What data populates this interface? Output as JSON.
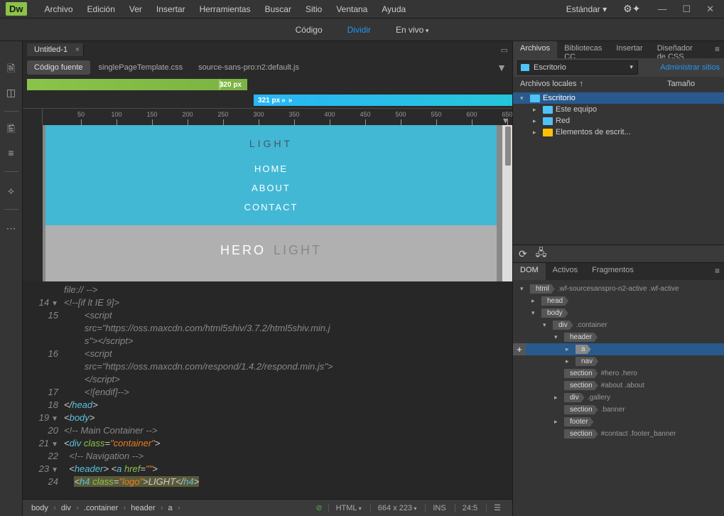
{
  "app": {
    "logo": "Dw"
  },
  "menu": [
    "Archivo",
    "Edición",
    "Ver",
    "Insertar",
    "Herramientas",
    "Buscar",
    "Sitio",
    "Ventana",
    "Ayuda"
  ],
  "workspace": "Estándar",
  "viewModes": {
    "code": "Código",
    "split": "Dividir",
    "live": "En vivo",
    "active": "split"
  },
  "document": {
    "tab": "Untitled-1",
    "sourceBtn": "Código fuente",
    "relatedFiles": [
      "singlePageTemplate.css",
      "source-sans-pro:n2:default.js"
    ]
  },
  "mediaQueries": {
    "bp1": "320  px",
    "bp2": "321  px"
  },
  "ruler": {
    "ticks": [
      50,
      100,
      150,
      200,
      250,
      300,
      350,
      400,
      450,
      500,
      550,
      600,
      650
    ]
  },
  "preview": {
    "logo": "LIGHT",
    "nav": [
      "HOME",
      "ABOUT",
      "CONTACT"
    ],
    "hero1": "HERO",
    "hero2": "LIGHT"
  },
  "code": {
    "lines": [
      {
        "n": "",
        "html": "<span class='c-comment'>file:// --&gt;</span>"
      },
      {
        "n": "14",
        "fold": true,
        "html": "<span class='c-comment'>&lt;!--[if lt IE 9]&gt;</span>"
      },
      {
        "n": "15",
        "html": "        <span class='c-comment'>&lt;script</span>"
      },
      {
        "n": "",
        "html": "        <span class='c-comment'>src=\"https://oss.maxcdn.com/html5shiv/3.7.2/html5shiv.min.j</span>"
      },
      {
        "n": "",
        "html": "        <span class='c-comment'>s\"&gt;&lt;/script&gt;</span>"
      },
      {
        "n": "16",
        "html": "        <span class='c-comment'>&lt;script</span>"
      },
      {
        "n": "",
        "html": "        <span class='c-comment'>src=\"https://oss.maxcdn.com/respond/1.4.2/respond.min.js\"&gt;</span>"
      },
      {
        "n": "",
        "html": "        <span class='c-comment'>&lt;/script&gt;</span>"
      },
      {
        "n": "17",
        "html": "        <span class='c-comment'>&lt;![endif]--&gt;</span>"
      },
      {
        "n": "18",
        "html": "<span class='c-bracket'>&lt;/</span><span class='c-tag'>head</span><span class='c-bracket'>&gt;</span>"
      },
      {
        "n": "19",
        "fold": true,
        "html": "<span class='c-bracket'>&lt;</span><span class='c-tag'>body</span><span class='c-bracket'>&gt;</span>"
      },
      {
        "n": "20",
        "html": "<span class='c-comment'>&lt;!-- Main Container --&gt;</span>"
      },
      {
        "n": "21",
        "fold": true,
        "html": "<span class='c-bracket'>&lt;</span><span class='c-tag'>div</span> <span class='c-attr'>class</span><span class='c-bracket'>=</span><span class='c-string'>\"container\"</span><span class='c-bracket'>&gt;</span>"
      },
      {
        "n": "22",
        "html": "  <span class='c-comment'>&lt;!-- Navigation --&gt;</span>"
      },
      {
        "n": "23",
        "fold": true,
        "html": "  <span class='c-bracket'>&lt;</span><span class='c-tag'>header</span><span class='c-bracket'>&gt;</span> <span class='c-bracket'>&lt;</span><span class='c-tag'>a</span> <span class='c-attr'>href</span><span class='c-bracket'>=</span><span class='c-string'>\"\"</span><span class='c-bracket'>&gt;</span>"
      },
      {
        "n": "24",
        "html": "    <span class='hl'><span class='c-bracket'>&lt;</span><span class='c-tag'>h4</span> <span class='c-attr'>class</span><span class='c-bracket'>=</span><span class='c-string'>\"logo\"</span><span class='c-bracket'>&gt;</span><span class='c-text'>LIGHT</span><span class='c-bracket'>&lt;/</span><span class='c-tag'>h4</span><span class='c-bracket'>&gt;</span></span>"
      }
    ]
  },
  "breadcrumb": [
    "body",
    "div",
    ".container",
    "header",
    "a"
  ],
  "status": {
    "lang": "HTML",
    "size": "664 x 223",
    "mode": "INS",
    "pos": "24:5"
  },
  "rightPanels": {
    "filesTabs": [
      "Archivos",
      "Bibliotecas CC",
      "Insertar",
      "Diseñador de CSS"
    ],
    "siteDrop": "Escritorio",
    "adminLink": "Administrar sitios",
    "listHeaders": {
      "name": "Archivos locales",
      "size": "Tamaño"
    },
    "fileTree": [
      {
        "indent": 0,
        "arrow": "▾",
        "icon": "f-desktop",
        "label": "Escritorio",
        "selected": true
      },
      {
        "indent": 1,
        "arrow": "▸",
        "icon": "f-pc",
        "label": "Este equipo"
      },
      {
        "indent": 1,
        "arrow": "▸",
        "icon": "f-net",
        "label": "Red"
      },
      {
        "indent": 1,
        "arrow": "▸",
        "icon": "f-folder",
        "label": "Elementos de escrit..."
      }
    ],
    "domTabs": [
      "DOM",
      "Activos",
      "Fragmentos"
    ],
    "domTree": [
      {
        "indent": 0,
        "arrow": "▾",
        "tag": "html",
        "cls": ".wf-sourcesanspro-n2-active .wf-active"
      },
      {
        "indent": 1,
        "arrow": "▸",
        "tag": "head"
      },
      {
        "indent": 1,
        "arrow": "▾",
        "tag": "body"
      },
      {
        "indent": 2,
        "arrow": "▾",
        "tag": "div",
        "cls": ".container"
      },
      {
        "indent": 3,
        "arrow": "▾",
        "tag": "header"
      },
      {
        "indent": 4,
        "arrow": "▸",
        "tag": "a",
        "selected": true,
        "addBtn": true
      },
      {
        "indent": 4,
        "arrow": "▸",
        "tag": "nav"
      },
      {
        "indent": 3,
        "arrow": "",
        "tag": "section",
        "cls": "#hero .hero"
      },
      {
        "indent": 3,
        "arrow": "",
        "tag": "section",
        "cls": "#about .about"
      },
      {
        "indent": 3,
        "arrow": "▸",
        "tag": "div",
        "cls": ".gallery"
      },
      {
        "indent": 3,
        "arrow": "",
        "tag": "section",
        "cls": ".banner"
      },
      {
        "indent": 3,
        "arrow": "▸",
        "tag": "footer"
      },
      {
        "indent": 3,
        "arrow": "",
        "tag": "section",
        "cls": "#contact .footer_banner"
      }
    ]
  }
}
